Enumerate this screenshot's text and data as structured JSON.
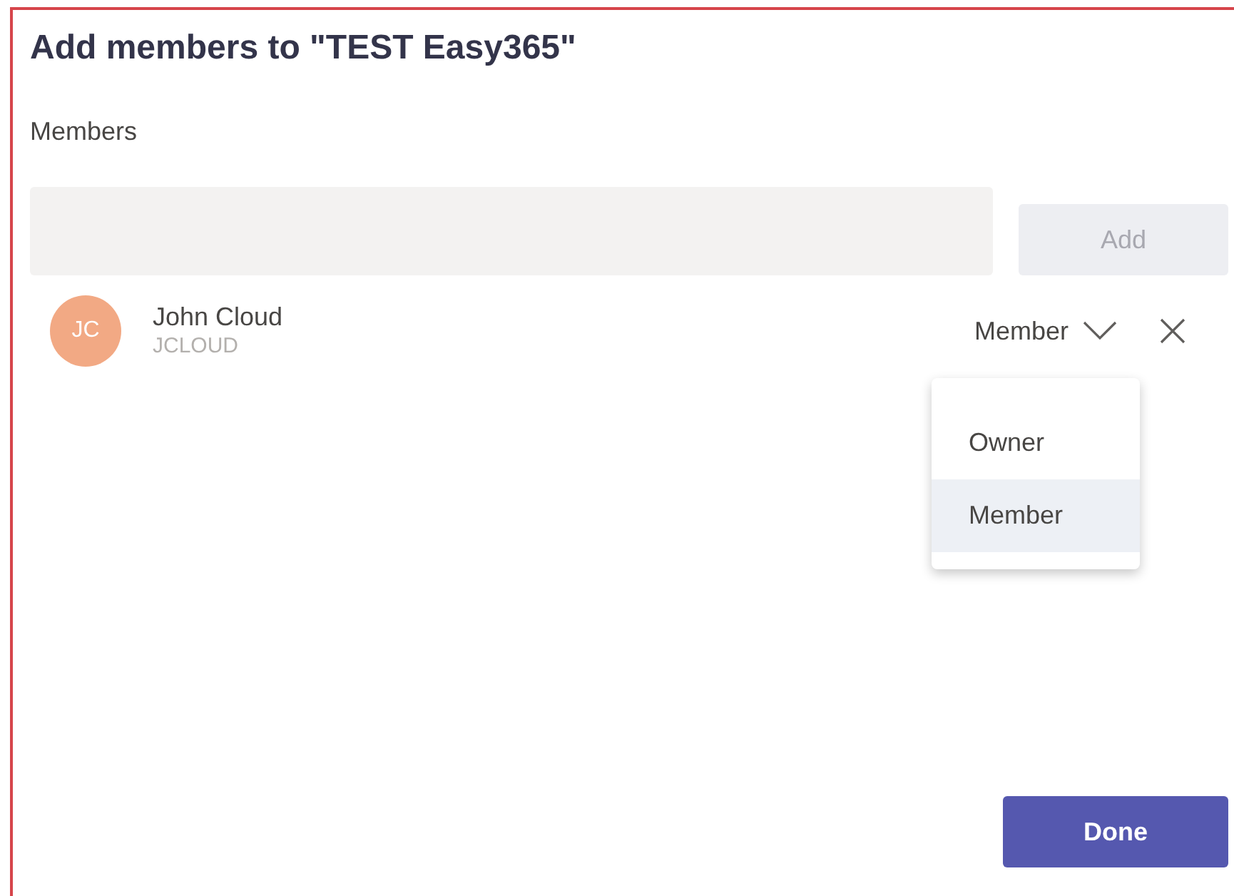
{
  "dialog": {
    "title": "Add members to \"TEST Easy365\"",
    "field_label": "Members"
  },
  "add_button": {
    "label": "Add",
    "disabled": true
  },
  "members": [
    {
      "initials": "JC",
      "name": "John Cloud",
      "username": "JCLOUD",
      "color": "#f2a984",
      "role": "Member",
      "menu_open": true
    }
  ],
  "role_menu": [
    {
      "label": "Owner",
      "selected": false
    },
    {
      "label": "Member",
      "selected": true
    }
  ],
  "done_button": {
    "label": "Done"
  }
}
